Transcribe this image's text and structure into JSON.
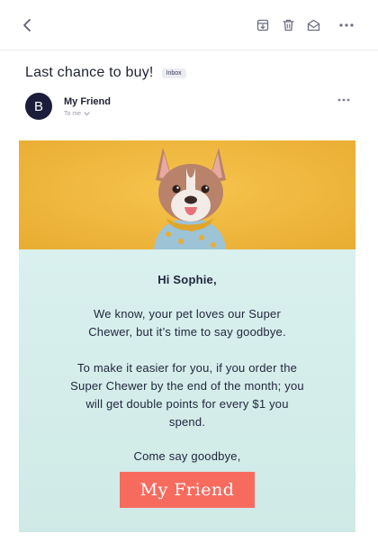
{
  "toolbar": {
    "back_icon": "chevron-left-icon",
    "archive_icon": "archive-icon",
    "delete_icon": "trash-icon",
    "mark_icon": "envelope-open-icon",
    "more_icon": "more-horizontal-icon"
  },
  "email": {
    "subject": "Last chance to buy!",
    "label": "Inbox",
    "sender": {
      "initial": "B",
      "name": "My Friend",
      "recipient": "To me"
    }
  },
  "body": {
    "hero_image": "french-bulldog-photo",
    "greeting": "Hi Sophie,",
    "paragraph1": "We know, your pet loves our Super Chewer, but it’s time to say goodbye.",
    "paragraph2": "To make it easier for you, if you order the Super Chewer by the end of the month; you will get double points for every $1 you spend.",
    "closing": "Come say goodbye,",
    "signature": "My Friend"
  },
  "colors": {
    "hero_background": "#f0b83c",
    "content_background": "#d9f0ee",
    "signature_button": "#f76b5f",
    "avatar": "#1b1d3a"
  }
}
